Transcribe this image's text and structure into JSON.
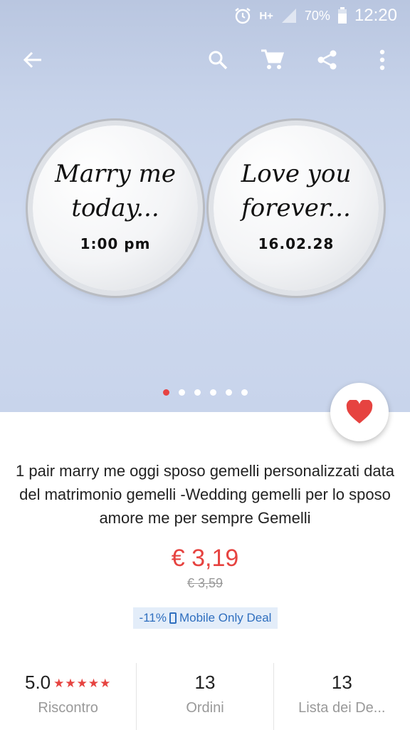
{
  "status_bar": {
    "network": "H+",
    "battery": "70%",
    "time": "12:20"
  },
  "app_bar": {
    "back_icon": "arrow-back-icon",
    "search_icon": "search-icon",
    "cart_icon": "shopping-cart-icon",
    "share_icon": "share-icon",
    "more_icon": "more-vert-icon"
  },
  "product_image": {
    "left_cufflink": [
      "Marry me",
      "today...",
      "1:00 pm"
    ],
    "right_cufflink": [
      "Love you",
      "forever...",
      "16.02.28"
    ],
    "carousel_count": 6,
    "carousel_active": 0
  },
  "product": {
    "title": "1 pair marry me oggi sposo gemelli personalizzati data del matrimonio gemelli  -Wedding gemelli per lo sposo amore me per sempre  Gemelli",
    "price": "€ 3,19",
    "old_price": "€ 3,59",
    "discount": "-11%",
    "deal_label": "Mobile Only Deal"
  },
  "stats": [
    {
      "value": "5.0",
      "stars": "★★★★★",
      "label": "Riscontro"
    },
    {
      "value": "13",
      "label": "Ordini"
    },
    {
      "value": "13",
      "label": "Lista dei De..."
    }
  ],
  "colors": {
    "accent": "#e64340",
    "deal_text": "#2f6fbf",
    "deal_bg": "#e3edf9"
  }
}
